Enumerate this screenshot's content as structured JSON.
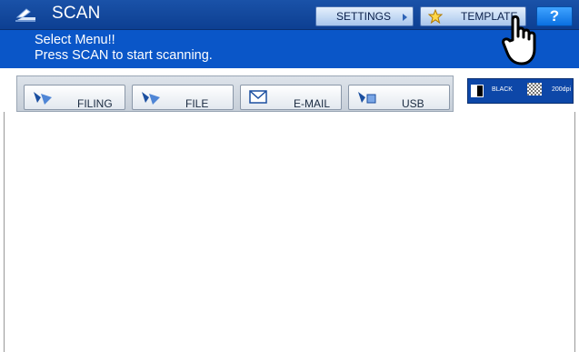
{
  "header": {
    "title": "SCAN",
    "icon": "scanner-icon",
    "settings_label": "SETTINGS",
    "template_label": "TEMPLATE",
    "help_label": "?"
  },
  "message": {
    "line1": "Select Menu!!",
    "line2": "Press SCAN to start scanning."
  },
  "functions": [
    {
      "label": "FILING",
      "icon": "filing-icon"
    },
    {
      "label": "FILE",
      "icon": "file-icon"
    },
    {
      "label": "E-MAIL",
      "icon": "email-icon"
    },
    {
      "label": "USB",
      "icon": "usb-icon"
    }
  ],
  "status": {
    "color_mode": "BLACK",
    "resolution": "200dpi"
  },
  "colors": {
    "title_bar": "#0d3f92",
    "message_bar": "#0a56c8",
    "help_button": "#0a6fe0"
  }
}
